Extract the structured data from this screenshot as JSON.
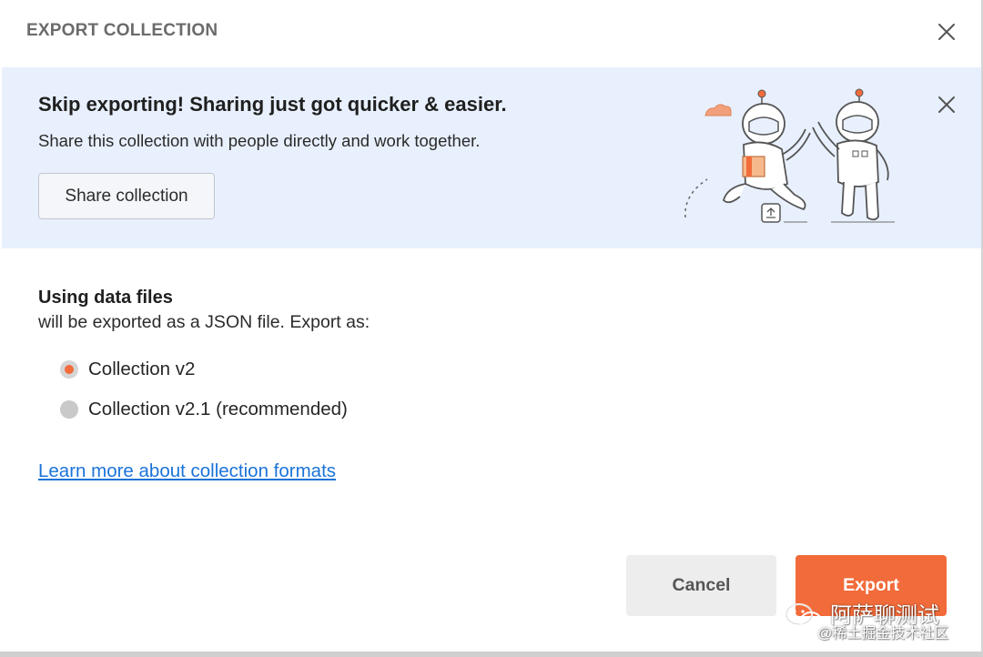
{
  "dialog": {
    "title": "EXPORT COLLECTION"
  },
  "banner": {
    "title": "Skip exporting! Sharing just got quicker & easier.",
    "subtitle": "Share this collection with people directly and work together.",
    "share_button": "Share collection"
  },
  "format": {
    "heading": "Using data files",
    "description": "will be exported as a JSON file. Export as:",
    "options": [
      {
        "label": "Collection v2",
        "selected": true
      },
      {
        "label": "Collection v2.1 (recommended)",
        "selected": false
      }
    ],
    "learn_more": "Learn more about collection formats"
  },
  "footer": {
    "cancel_label": "Cancel",
    "export_label": "Export"
  },
  "watermark": {
    "line1": "阿萨聊测试",
    "line2": "@稀土掘金技术社区"
  },
  "icons": {
    "dialog_close": "close-icon",
    "banner_close": "close-icon",
    "illustration": "astronauts-sharing-illustration"
  },
  "colors": {
    "accent": "#f26b3a",
    "link": "#1a73d9",
    "banner_bg": "#e8f0fd",
    "cancel_bg": "#ededed"
  }
}
